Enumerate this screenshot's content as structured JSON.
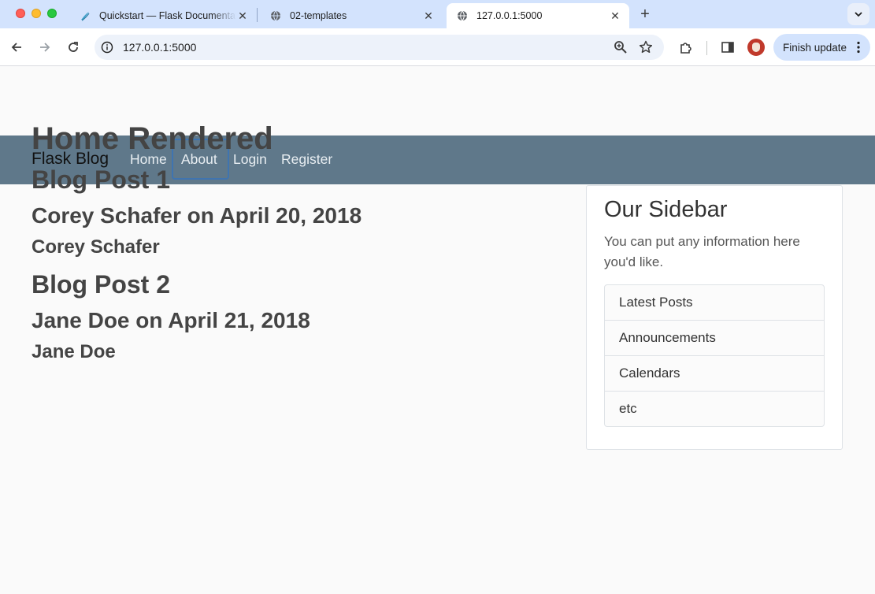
{
  "browser": {
    "tabs": [
      {
        "title": "Quickstart — Flask Documentation",
        "active": false,
        "favicon": "flask-favicon-icon"
      },
      {
        "title": "02-templates",
        "active": false,
        "favicon": "globe-icon"
      },
      {
        "title": "127.0.0.1:5000",
        "active": true,
        "favicon": "globe-icon"
      }
    ],
    "url": "127.0.0.1:5000",
    "update_button": "Finish update"
  },
  "site": {
    "brand": "Flask Blog",
    "nav": {
      "home": "Home",
      "about": "About",
      "login": "Login",
      "register": "Register"
    },
    "main": {
      "heading": "Home Rendered",
      "posts": [
        {
          "title": "Blog Post 1",
          "meta": "Corey Schafer on April 20, 2018",
          "author": "Corey Schafer"
        },
        {
          "title": "Blog Post 2",
          "meta": "Jane Doe on April 21, 2018",
          "author": "Jane Doe"
        }
      ]
    },
    "sidebar": {
      "title": "Our Sidebar",
      "text": "You can put any information here you'd like.",
      "items": [
        "Latest Posts",
        "Announcements",
        "Calendars",
        "etc"
      ]
    }
  }
}
